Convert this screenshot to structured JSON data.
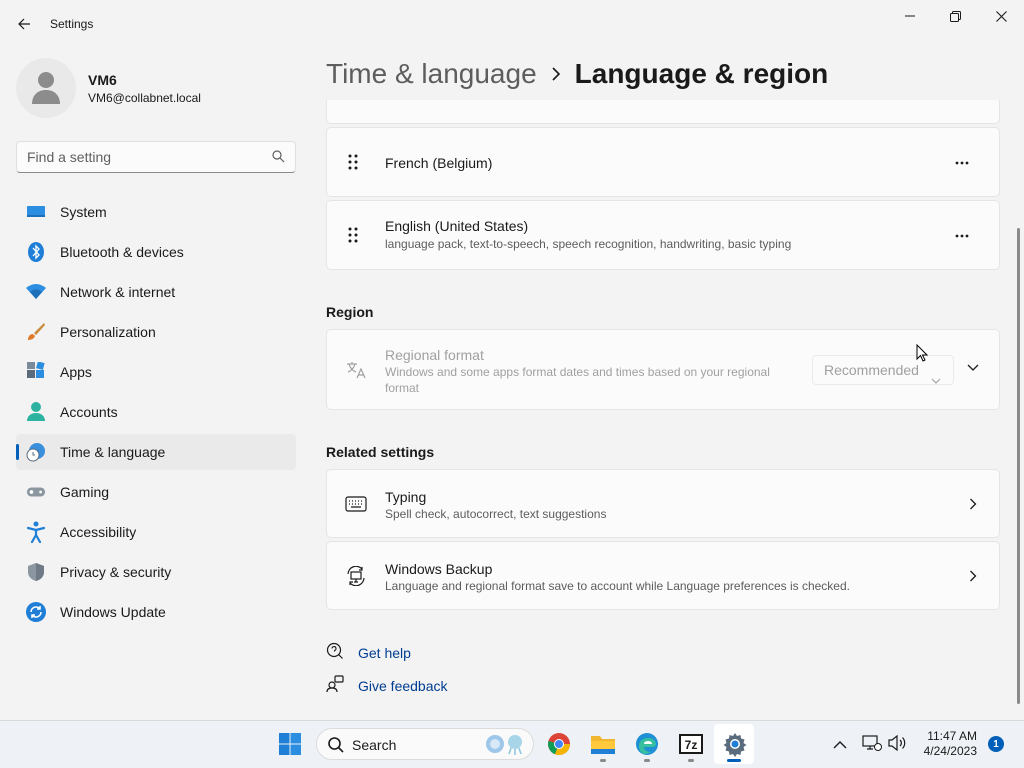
{
  "window": {
    "app_title": "Settings"
  },
  "user": {
    "name": "VM6",
    "email": "VM6@collabnet.local"
  },
  "search": {
    "placeholder": "Find a setting"
  },
  "sidebar": {
    "items": [
      {
        "label": "System",
        "icon": "system-icon"
      },
      {
        "label": "Bluetooth & devices",
        "icon": "bluetooth-icon"
      },
      {
        "label": "Network & internet",
        "icon": "wifi-icon"
      },
      {
        "label": "Personalization",
        "icon": "brush-icon"
      },
      {
        "label": "Apps",
        "icon": "apps-icon"
      },
      {
        "label": "Accounts",
        "icon": "accounts-icon"
      },
      {
        "label": "Time & language",
        "icon": "clock-globe-icon",
        "active": true
      },
      {
        "label": "Gaming",
        "icon": "gamepad-icon"
      },
      {
        "label": "Accessibility",
        "icon": "accessibility-icon"
      },
      {
        "label": "Privacy & security",
        "icon": "shield-icon"
      },
      {
        "label": "Windows Update",
        "icon": "update-icon"
      }
    ]
  },
  "breadcrumb": {
    "parent": "Time & language",
    "current": "Language & region"
  },
  "languages": [
    {
      "name": "French (Belgium)",
      "details": ""
    },
    {
      "name": "English (United States)",
      "details": "language pack, text-to-speech, speech recognition, handwriting, basic typing"
    }
  ],
  "region": {
    "section_title": "Region",
    "regional_format": {
      "title": "Regional format",
      "description_line1": "Windows and some apps format dates and times based on your regional",
      "description_line2": "format",
      "dropdown_value": "Recommended"
    }
  },
  "related": {
    "section_title": "Related settings",
    "items": [
      {
        "title": "Typing",
        "description": "Spell check, autocorrect, text suggestions"
      },
      {
        "title": "Windows Backup",
        "description": "Language and regional format save to account while Language preferences is checked."
      }
    ]
  },
  "links": {
    "get_help": "Get help",
    "give_feedback": "Give feedback"
  },
  "taskbar": {
    "search_label": "Search",
    "time": "11:47 AM",
    "date": "4/24/2023",
    "notification_count": "1"
  },
  "colors": {
    "accent": "#005fb8",
    "background": "#f3f3f3",
    "card": "#fbfbfb"
  }
}
